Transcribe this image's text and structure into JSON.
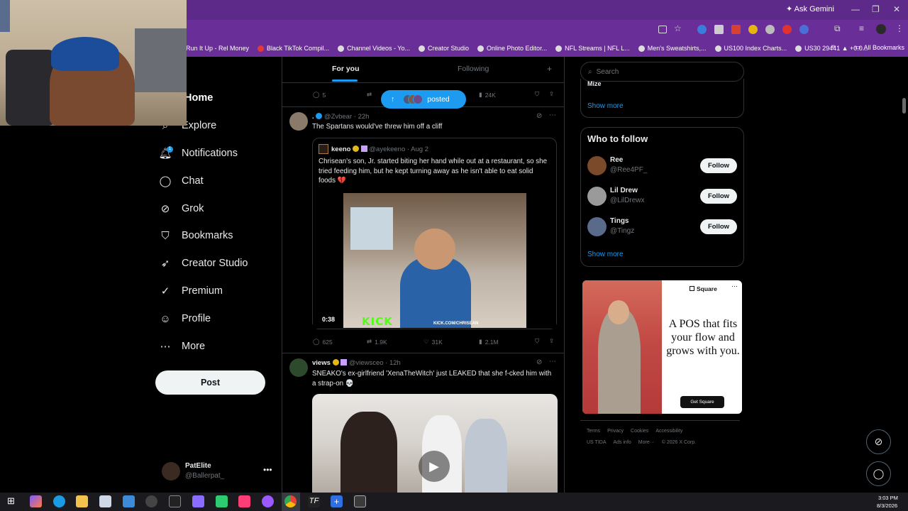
{
  "browser": {
    "ask_gemini": "Ask Gemini",
    "bookmarks": [
      "Run It Up - Rel Money",
      "Black TikTok Compil...",
      "Channel Videos - Yo...",
      "Creator Studio",
      "Online Photo Editor...",
      "NFL Streams | NFL L...",
      "Men's Sweatshirts,...",
      "US100 Index Charts...",
      "US30 29441 ▲ +0.0..."
    ],
    "all_bookmarks": "All Bookmarks"
  },
  "nav": {
    "home": "Home",
    "explore": "Explore",
    "notifications": "Notifications",
    "chat": "Chat",
    "grok": "Grok",
    "bookmarks": "Bookmarks",
    "creator_studio": "Creator Studio",
    "premium": "Premium",
    "profile": "Profile",
    "more": "More",
    "post": "Post",
    "notifications_badge": "1"
  },
  "account": {
    "name": "PatElite",
    "handle": "@Ballerpat_"
  },
  "feed": {
    "tabs": {
      "for_you": "For you",
      "following": "Following",
      "plus": "+"
    },
    "posted_pill": "posted",
    "prev_actions": {
      "replies": "5",
      "views": "24K"
    },
    "tweet1": {
      "handle_time": "@Zvbear · 22h",
      "text": "The Spartans would've threw him off a cliff",
      "quote": {
        "name": "keeno",
        "handle_time": "@ayekeeno · Aug 2",
        "text": "Chrisean's son, Jr. started biting her hand while out at a restaurant, so she tried feeding him, but he kept turning away as he isn't able to eat solid foods 💔",
        "video_time": "0:38",
        "watermark": "KICK",
        "watermark_url": "KICK.COM/CHRISEAN"
      },
      "actions": {
        "replies": "625",
        "reposts": "1.9K",
        "likes": "31K",
        "views": "2.1M"
      }
    },
    "tweet2": {
      "name": "views",
      "handle_time": "@viewsceo · 12h",
      "text": "SNEAKO's ex-girlfriend 'XenaTheWitch' just LEAKED that she f-cked him with a strap-on 💀"
    }
  },
  "sidebar": {
    "search_placeholder": "Search",
    "trend_cut": "Mize",
    "show_more_1": "Show more",
    "who_to_follow": "Who to follow",
    "follow_items": [
      {
        "name": "Ree",
        "handle": "@Ree4PF_",
        "button": "Follow"
      },
      {
        "name": "Lil Drew",
        "handle": "@LilDrewx",
        "button": "Follow"
      },
      {
        "name": "Tings",
        "handle": "@Tingz",
        "button": "Follow"
      }
    ],
    "show_more_2": "Show more",
    "ad": {
      "brand": "Square",
      "headline": "A POS that fits your flow and grows with you.",
      "cta": "Get Square"
    },
    "footer": {
      "row1": [
        "Terms",
        "Privacy",
        "Cookies",
        "Accessibility"
      ],
      "row2": [
        "US TIDA",
        "Ads info",
        "More···",
        "© 2026 X Corp."
      ]
    }
  },
  "taskbar": {
    "time": "3:03 PM",
    "date": "8/3/2026"
  }
}
